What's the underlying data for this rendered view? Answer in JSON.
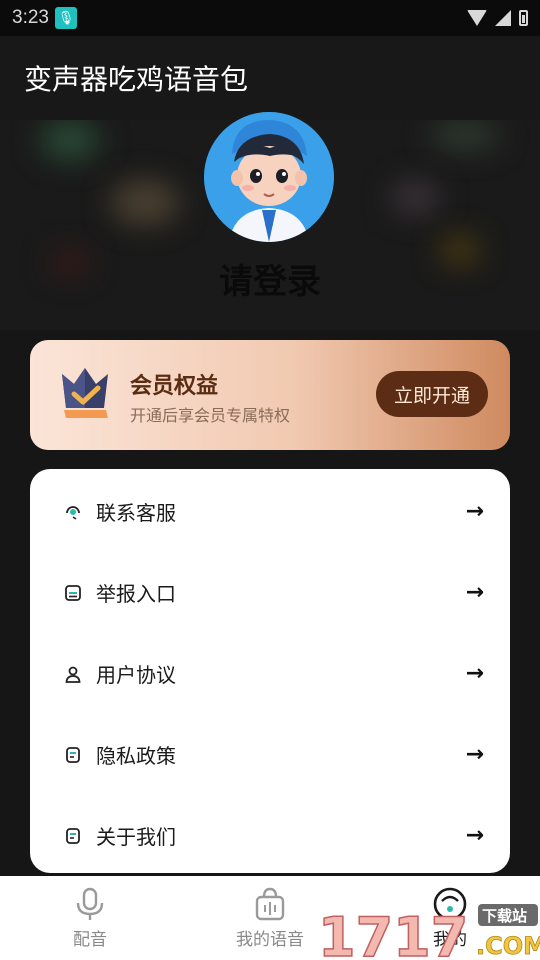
{
  "status_bar": {
    "time": "3:23"
  },
  "app_bar": {
    "title": "变声器吃鸡语音包"
  },
  "profile": {
    "login_text": "请登录"
  },
  "vip": {
    "title": "会员权益",
    "subtitle": "开通后享会员专属特权",
    "button": "立即开通"
  },
  "menu": {
    "items": [
      {
        "label": "联系客服",
        "icon": "headset-icon"
      },
      {
        "label": "举报入口",
        "icon": "report-icon"
      },
      {
        "label": "用户协议",
        "icon": "user-icon"
      },
      {
        "label": "隐私政策",
        "icon": "document-icon"
      },
      {
        "label": "关于我们",
        "icon": "info-document-icon"
      }
    ]
  },
  "bottom_nav": {
    "items": [
      {
        "label": "配音",
        "icon": "microphone-icon"
      },
      {
        "label": "我的语音",
        "icon": "voice-bag-icon"
      },
      {
        "label": "我的",
        "icon": "profile-icon",
        "active": true
      }
    ]
  },
  "watermark": {
    "text": "17173.COM",
    "badge": "下载站"
  },
  "colors": {
    "vip_button": "#5c2c14",
    "vip_title": "#5a2d12",
    "menu_bg": "#ffffff",
    "accent_icon": "#2ab8b0"
  }
}
